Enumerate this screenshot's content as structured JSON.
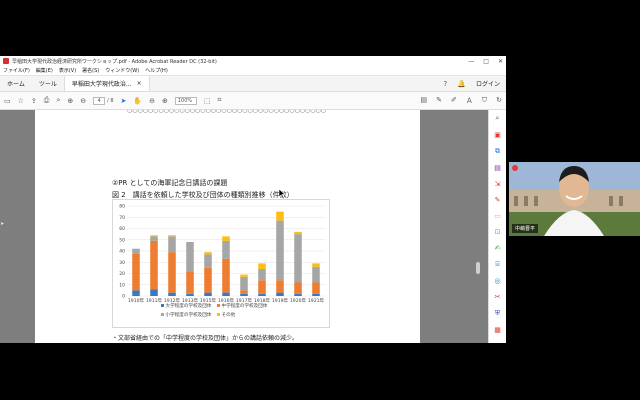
{
  "window": {
    "title": "早稲田大学現代政治経済研究所ワークショップ.pdf - Adobe Acrobat Reader DC (32-bit)",
    "controls": [
      "—",
      "□",
      "✕"
    ]
  },
  "menu": [
    "ファイル(F)",
    "編集(E)",
    "表示(V)",
    "署名(S)",
    "ウィンドウ(W)",
    "ヘルプ(H)"
  ],
  "tabs": {
    "home": "ホーム",
    "tools": "ツール",
    "doc": "早稲田大学現代政治...",
    "close": "×"
  },
  "account": {
    "login": "ログイン"
  },
  "toolbar": {
    "page_current": "4",
    "page_total": "/ 8",
    "zoom": "100%"
  },
  "document": {
    "cut_text": "　　○○○○○○○○○○○○○○○○○○○○○○○○○○○○○○○○○○○○○○",
    "heading": "②PR としての海軍記念日講話の課題",
    "figure_title": "図 2　講話を依頼した学校及び団体の種類別推移（件数）",
    "footnote": "・文部省経由での「中学程度の学校及団体」からの講話依頼の減少。",
    "page_number": "4"
  },
  "video": {
    "participant_name": "中嶋晋平"
  },
  "chart_data": {
    "type": "bar",
    "stacked": true,
    "title": "",
    "xlabel": "",
    "ylabel": "",
    "ylim": [
      0,
      80
    ],
    "yticks": [
      0,
      10,
      20,
      30,
      40,
      50,
      60,
      70,
      80
    ],
    "grid": true,
    "legend_position": "bottom",
    "categories": [
      "1910年",
      "1911年",
      "1912年",
      "1913年",
      "1915年",
      "1916年",
      "1917年",
      "1918年",
      "1919年",
      "1920年",
      "1921年"
    ],
    "series": [
      {
        "name": "大学程度の学校及団体",
        "color": "#3a78c2",
        "values": [
          5,
          6,
          3,
          2,
          3,
          3,
          2,
          2,
          3,
          2,
          2
        ]
      },
      {
        "name": "中学程度の学校及団体",
        "color": "#ee7d31",
        "values": [
          33,
          43,
          36,
          20,
          22,
          30,
          3,
          12,
          11,
          10,
          10
        ]
      },
      {
        "name": "小学程度の学校及団体",
        "color": "#a6a6a6",
        "values": [
          4,
          4,
          14,
          26,
          12,
          16,
          12,
          10,
          53,
          43,
          14
        ]
      },
      {
        "name": "その他",
        "color": "#fbbf14",
        "values": [
          0,
          1,
          1,
          0,
          2,
          4,
          2,
          5,
          8,
          2,
          3
        ]
      }
    ]
  },
  "colors": {
    "accent": "#1a73e8",
    "pdf_red": "#d32f2f",
    "gray_bg": "#7e7e7e"
  }
}
